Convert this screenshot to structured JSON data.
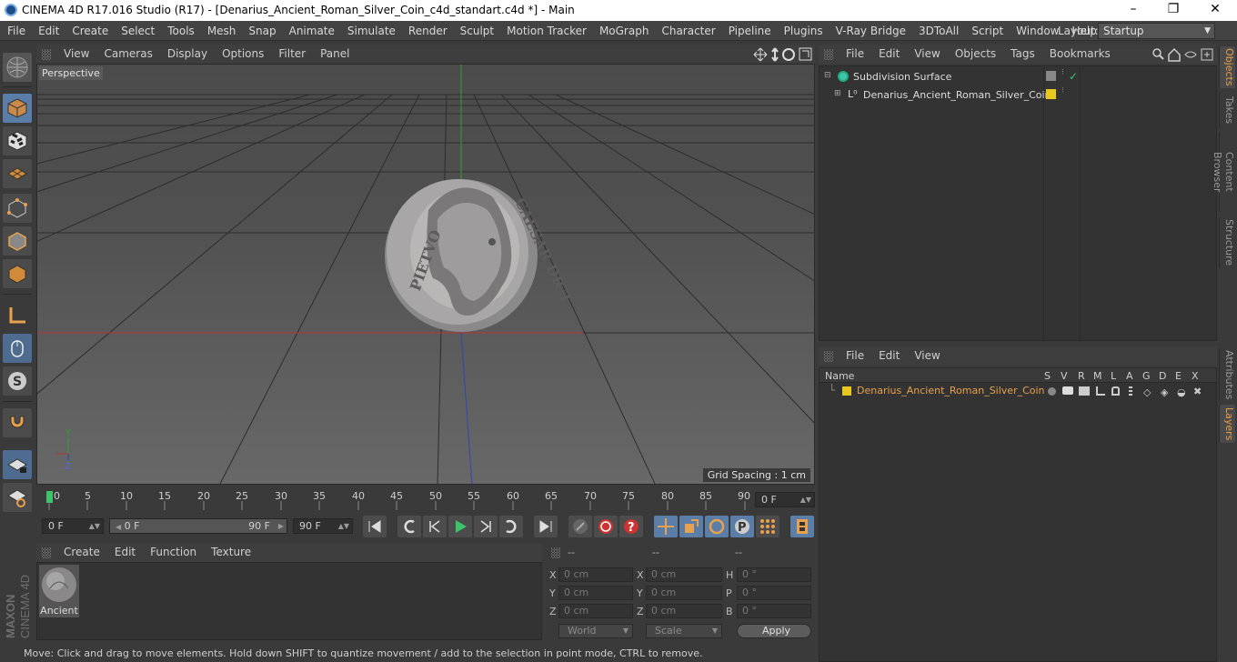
{
  "title": "CINEMA 4D R17.016 Studio (R17) - [Denarius_Ancient_Roman_Silver_Coin_c4d_standart.c4d *] - Main",
  "window_controls": [
    "–",
    "❐",
    "✕"
  ],
  "menu": [
    "File",
    "Edit",
    "Create",
    "Select",
    "Tools",
    "Mesh",
    "Snap",
    "Animate",
    "Simulate",
    "Render",
    "Sculpt",
    "Motion Tracker",
    "MoGraph",
    "Character",
    "Pipeline",
    "Plugins",
    "V-Ray Bridge",
    "3DToAll",
    "Script",
    "Window",
    "Help"
  ],
  "layout": {
    "label": "Layout:",
    "value": "Startup"
  },
  "viewport": {
    "menu": [
      "View",
      "Cameras",
      "Display",
      "Options",
      "Filter",
      "Panel"
    ],
    "camera_label": "Perspective",
    "grid_spacing": "Grid Spacing : 1 cm",
    "axis_y": "Y",
    "axis_z": "Z"
  },
  "coin_text": {
    "left": "PIETVO",
    "right": "CAESAR DICT"
  },
  "timeline": {
    "ticks": [
      "0",
      "5",
      "10",
      "15",
      "20",
      "25",
      "30",
      "35",
      "40",
      "45",
      "50",
      "55",
      "60",
      "65",
      "70",
      "75",
      "80",
      "85",
      "90"
    ],
    "current_frame": "0 F"
  },
  "transport": {
    "start": "0 F",
    "range_start": "0 F",
    "range_end": "90 F",
    "end": "90 F"
  },
  "material_manager": {
    "menu": [
      "Create",
      "Edit",
      "Function",
      "Texture"
    ],
    "material_name": "Ancient"
  },
  "coordinates": {
    "headers": [
      "--",
      "--",
      "--"
    ],
    "rows": [
      {
        "a_label": "X",
        "a": "0 cm",
        "b_label": "X",
        "b": "0 cm",
        "c_label": "H",
        "c": "0 °"
      },
      {
        "a_label": "Y",
        "a": "0 cm",
        "b_label": "Y",
        "b": "0 cm",
        "c_label": "P",
        "c": "0 °"
      },
      {
        "a_label": "Z",
        "a": "0 cm",
        "b_label": "Z",
        "b": "0 cm",
        "c_label": "B",
        "c": "0 °"
      }
    ],
    "world": "World",
    "scale": "Scale",
    "apply": "Apply"
  },
  "status": "Move: Click and drag to move elements. Hold down SHIFT to quantize movement / add to the selection in point mode, CTRL to remove.",
  "object_manager": {
    "menu": [
      "File",
      "Edit",
      "View",
      "Objects",
      "Tags",
      "Bookmarks"
    ],
    "objects": [
      {
        "name": "Subdivision Surface"
      },
      {
        "name": "Denarius_Ancient_Roman_Silver_Coin"
      }
    ]
  },
  "layer_manager": {
    "menu": [
      "File",
      "Edit",
      "View"
    ],
    "name_header": "Name",
    "columns": [
      "S",
      "V",
      "R",
      "M",
      "L",
      "A",
      "G",
      "D",
      "E",
      "X"
    ],
    "layers": [
      {
        "name": "Denarius_Ancient_Roman_Silver_Coin",
        "color": "#e8c81e"
      }
    ]
  },
  "right_tabs": [
    "Objects",
    "Takes",
    "Content Browser",
    "Structure",
    "Attributes",
    "Layers"
  ],
  "branding": {
    "maxon": "MAXON",
    "cinema": "CINEMA 4D"
  },
  "colors": {
    "accent": "#e8a14d",
    "selected_tool": "#5a7ea8",
    "layer_color": "#e8c81e"
  }
}
